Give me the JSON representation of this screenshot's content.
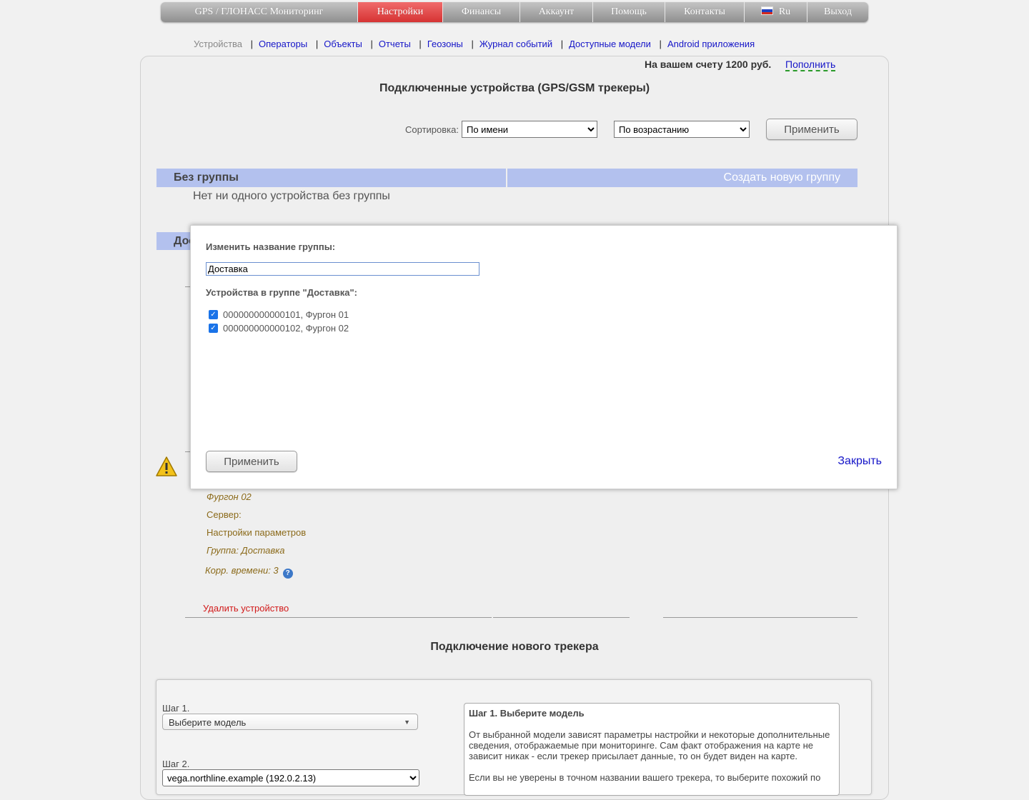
{
  "topnav": {
    "items": [
      "GPS / ГЛОНАСС Мониторинг",
      "Настройки",
      "Финансы",
      "Аккаунт",
      "Помощь",
      "Контакты",
      "Ru",
      "Выход"
    ],
    "active_color": "#d63333",
    "lang_icon": "russia-flag-icon"
  },
  "subnav": {
    "current": "Устройства",
    "links": [
      "Операторы",
      "Объекты",
      "Отчеты",
      "Геозоны",
      "Журнал событий",
      "Доступные модели",
      "Android приложения"
    ]
  },
  "account": {
    "balance_text": "На вашем счету 1200 руб.",
    "topup_label": "Пополнить"
  },
  "page_title": "Подключенные устройства (GPS/GSM трекеры)",
  "sort": {
    "label": "Сортировка:",
    "field_value": "По имени",
    "order_value": "По возрастанию",
    "apply_label": "Применить"
  },
  "groups": {
    "no_group_title": "Без группы",
    "create_group_label": "Создать новую группу",
    "no_group_empty": "Нет ни одного устройства без группы",
    "group2_title_partial": "Доставка"
  },
  "device": {
    "name": "Фургон 02",
    "server": "Сервер:",
    "params": "Настройки параметров",
    "group": "Группа: Доставка",
    "time_corr": "Корр. времени: 3",
    "delete_label": "Удалить устройство",
    "warning_icon": "warning-icon",
    "help_icon": "help-icon"
  },
  "new_tracker": {
    "title": "Подключение нового трекера",
    "step1_label": "Шаг 1.",
    "step1_value": "Выберите модель",
    "step2_label": "Шаг 2.",
    "step2_value": "vega.northline.example (192.0.2.13)",
    "info_title": "Шаг 1. Выберите модель",
    "info_p1": "От выбранной модели зависят параметры настройки и некоторые дополнительные сведения, отображаемые при мониторинге. Сам факт отображения на карте не зависит никак - если трекер присылает данные, то он будет виден на карте.",
    "info_p2": "Если вы не уверены в точном названии вашего трекера, то выберите похожий по"
  },
  "modal": {
    "rename_label": "Изменить название группы:",
    "group_name": "Доставка",
    "devices_label": "Устройства в группе \"Доставка\":",
    "devices": [
      {
        "label": "000000000000101, Фургон 01",
        "checked": true
      },
      {
        "label": "000000000000102, Фургон 02",
        "checked": true
      }
    ],
    "apply_label": "Применить",
    "close_label": "Закрыть"
  }
}
